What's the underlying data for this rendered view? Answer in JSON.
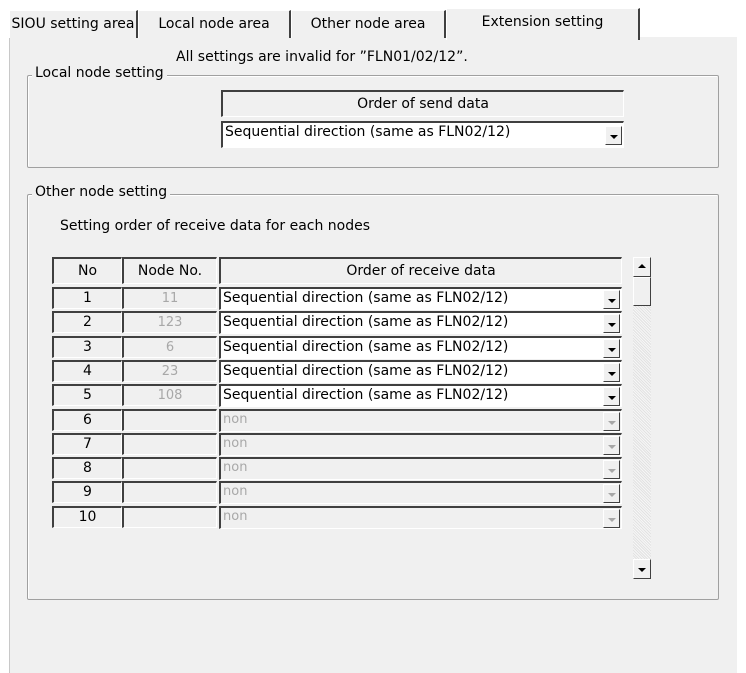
{
  "tabs": [
    {
      "label": "SIOU setting area",
      "active": false
    },
    {
      "label": "Local node area",
      "active": false
    },
    {
      "label": "Other node area",
      "active": false
    },
    {
      "label": "Extension setting",
      "active": true
    }
  ],
  "notice": "All settings are invalid for ”FLN01/02/12”.",
  "local_group": {
    "title": "Local node setting",
    "header": "Order of send data",
    "value": "Sequential direction (same as FLN02/12)"
  },
  "other_group": {
    "title": "Other node setting",
    "subtitle": "Setting order of receive data for each nodes",
    "columns": [
      "No",
      "Node No.",
      "Order of receive data"
    ],
    "rows": [
      {
        "no": "1",
        "node": "11",
        "order": "Sequential direction (same as FLN02/12)",
        "enabled": true
      },
      {
        "no": "2",
        "node": "123",
        "order": "Sequential direction (same as FLN02/12)",
        "enabled": true
      },
      {
        "no": "3",
        "node": "6",
        "order": "Sequential direction (same as FLN02/12)",
        "enabled": true
      },
      {
        "no": "4",
        "node": "23",
        "order": "Sequential direction (same as FLN02/12)",
        "enabled": true
      },
      {
        "no": "5",
        "node": "108",
        "order": "Sequential direction (same as FLN02/12)",
        "enabled": true
      },
      {
        "no": "6",
        "node": "",
        "order": "non",
        "enabled": false
      },
      {
        "no": "7",
        "node": "",
        "order": "non",
        "enabled": false
      },
      {
        "no": "8",
        "node": "",
        "order": "non",
        "enabled": false
      },
      {
        "no": "9",
        "node": "",
        "order": "non",
        "enabled": false
      },
      {
        "no": "10",
        "node": "",
        "order": "non",
        "enabled": false
      }
    ]
  }
}
